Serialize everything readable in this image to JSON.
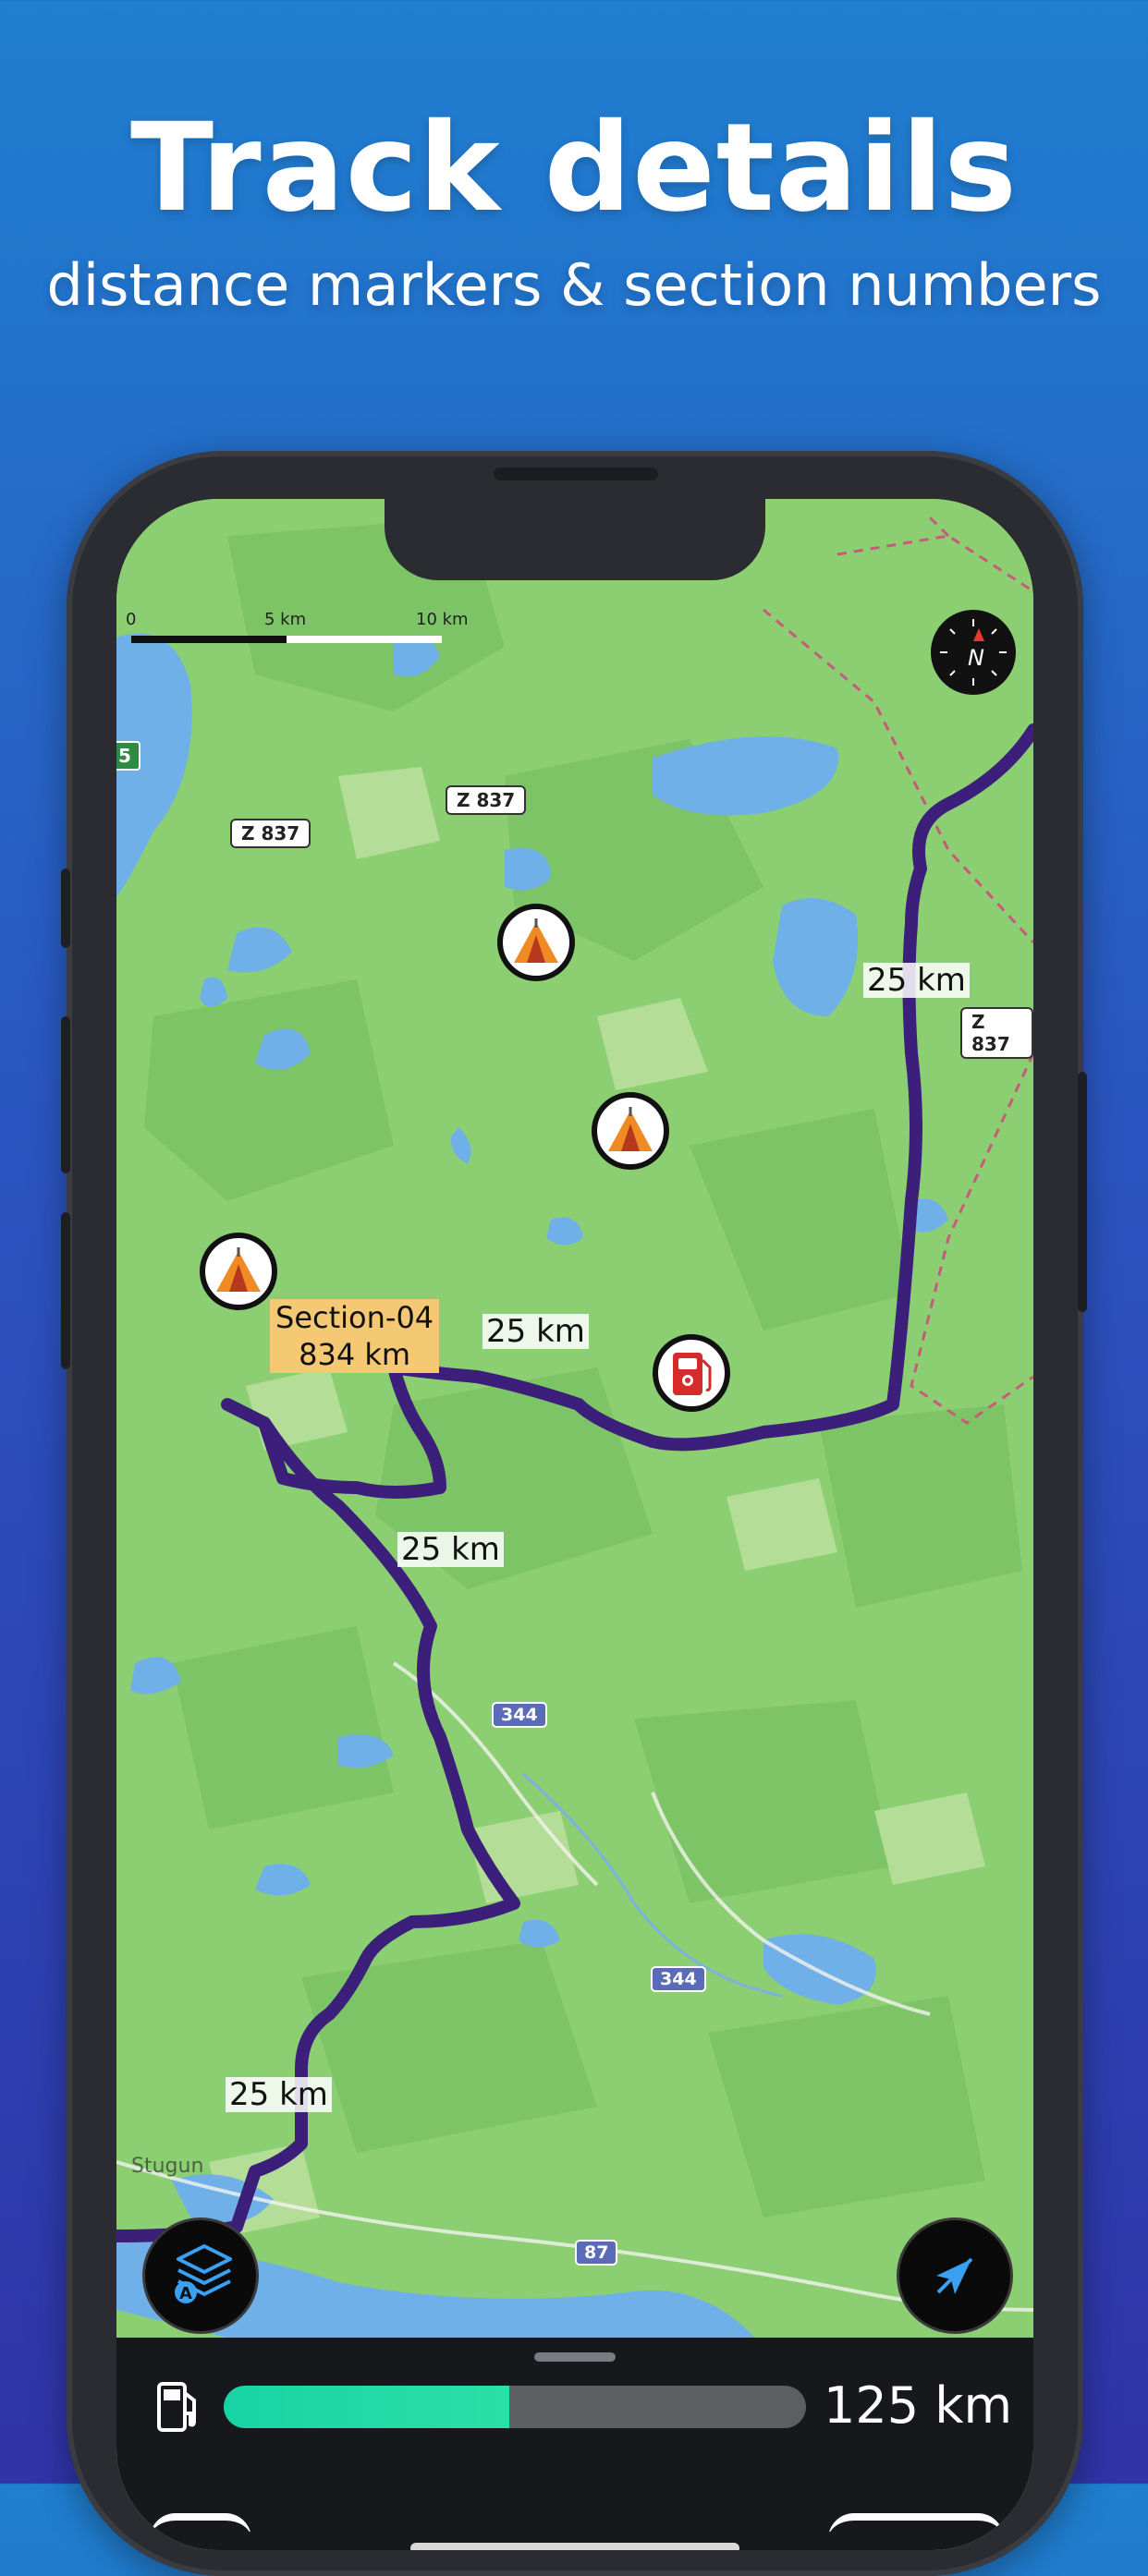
{
  "headline": {
    "title": "Track details",
    "subtitle": "distance markers & section numbers"
  },
  "map": {
    "scale": [
      "0",
      "5 km",
      "10 km"
    ],
    "road_signs": [
      "Z 837",
      "Z 837",
      "Z 837"
    ],
    "route_numbers": [
      "344",
      "344",
      "87"
    ],
    "partial_sign": "5",
    "place_fragment": "Stugun",
    "distance_markers": [
      "25 km",
      "25 km",
      "25 km",
      "25 km"
    ],
    "section": {
      "name": "Section-04",
      "distance": "834 km"
    },
    "compass_letter": "N",
    "route_color": "#3b1f7a"
  },
  "bottom_bar": {
    "fuel_level_percent": 49,
    "fuel_range": "125 km"
  }
}
